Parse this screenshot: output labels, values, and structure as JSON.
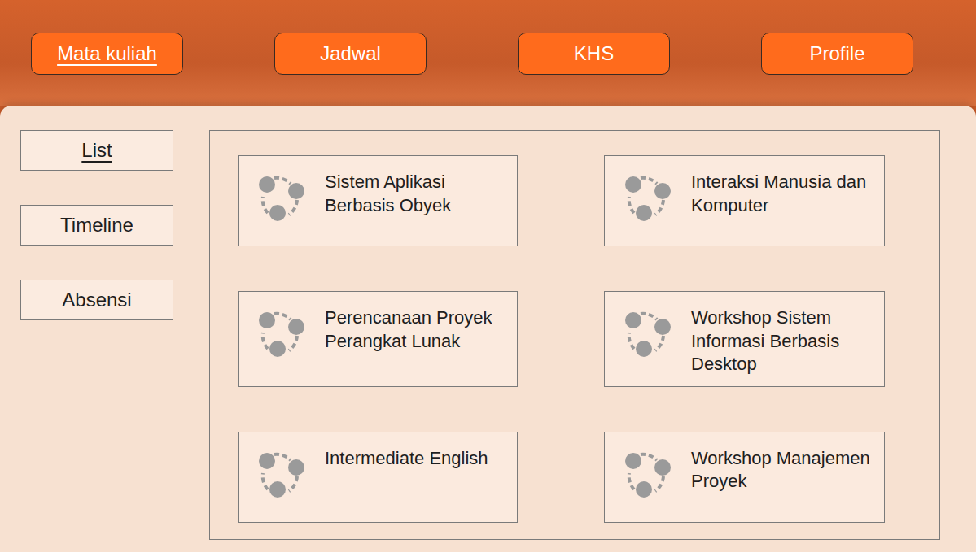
{
  "nav": [
    {
      "label": "Mata kuliah",
      "selected": true
    },
    {
      "label": "Jadwal",
      "selected": false
    },
    {
      "label": "KHS",
      "selected": false
    },
    {
      "label": "Profile",
      "selected": false
    }
  ],
  "sidebar": {
    "items": [
      {
        "label": "List",
        "selected": true
      },
      {
        "label": "Timeline",
        "selected": false
      },
      {
        "label": "Absensi",
        "selected": false
      }
    ]
  },
  "courses": [
    {
      "name": "Sistem Aplikasi Berbasis Obyek"
    },
    {
      "name": "Interaksi Manusia dan Komputer"
    },
    {
      "name": "Perencanaan Proyek Perangkat Lunak"
    },
    {
      "name": "Workshop Sistem Informasi Berbasis Desktop"
    },
    {
      "name": "Intermediate English"
    },
    {
      "name": "Workshop Manajemen Proyek"
    }
  ]
}
